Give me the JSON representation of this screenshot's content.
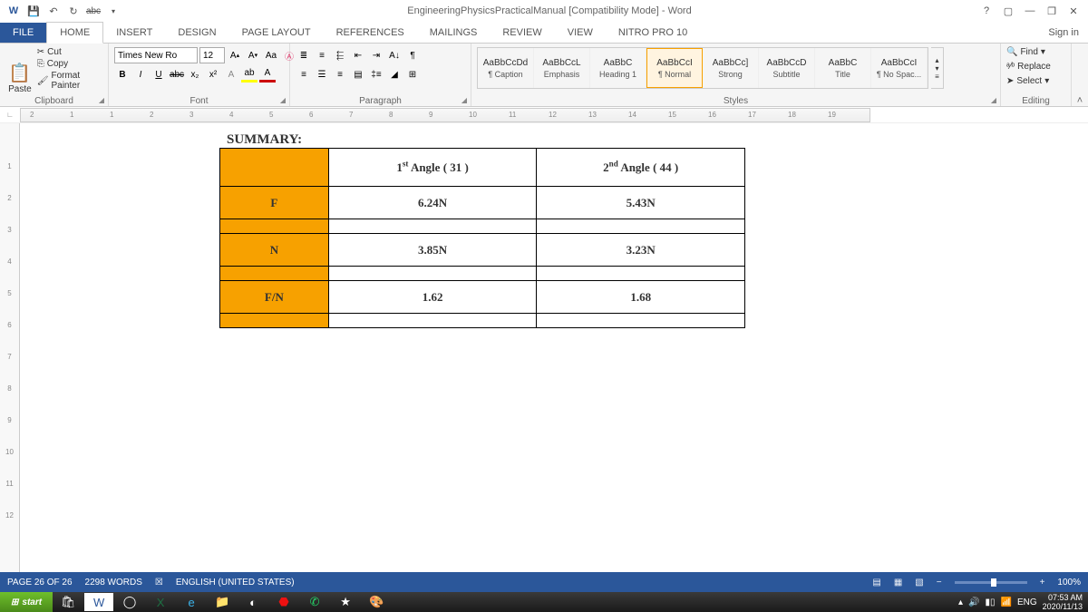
{
  "title": "EngineeringPhysicsPracticalManual [Compatibility Mode] - Word",
  "tabs": {
    "file": "FILE",
    "home": "HOME",
    "insert": "INSERT",
    "design": "DESIGN",
    "pagelayout": "PAGE LAYOUT",
    "references": "REFERENCES",
    "mailings": "MAILINGS",
    "review": "REVIEW",
    "view": "VIEW",
    "nitro": "NITRO PRO 10"
  },
  "signin": "Sign in",
  "clipboard": {
    "paste": "Paste",
    "cut": "Cut",
    "copy": "Copy",
    "painter": "Format Painter",
    "label": "Clipboard"
  },
  "font": {
    "name": "Times New Ro",
    "size": "12",
    "label": "Font"
  },
  "paragraph": {
    "label": "Paragraph"
  },
  "styles": {
    "label": "Styles",
    "items": [
      {
        "preview": "AaBbCcDd",
        "name": "¶ Caption"
      },
      {
        "preview": "AaBbCcL",
        "name": "Emphasis"
      },
      {
        "preview": "AaBbC",
        "name": "Heading 1"
      },
      {
        "preview": "AaBbCcI",
        "name": "¶ Normal"
      },
      {
        "preview": "AaBbCc]",
        "name": "Strong"
      },
      {
        "preview": "AaBbCcD",
        "name": "Subtitle"
      },
      {
        "preview": "AaBbC",
        "name": "Title"
      },
      {
        "preview": "AaBbCcI",
        "name": "¶ No Spac..."
      }
    ]
  },
  "editing": {
    "find": "Find",
    "replace": "Replace",
    "select": "Select",
    "label": "Editing"
  },
  "ruler_h": [
    "2",
    "1",
    "1",
    "2",
    "3",
    "4",
    "5",
    "6",
    "7",
    "8",
    "9",
    "10",
    "11",
    "12",
    "13",
    "14",
    "15",
    "16",
    "17",
    "18",
    "19"
  ],
  "ruler_v": [
    "1",
    "2",
    "3",
    "4",
    "5",
    "6",
    "7",
    "8",
    "9",
    "10",
    "11",
    "12"
  ],
  "doc": {
    "summary": "SUMMARY:",
    "hdr1_a": "1",
    "hdr1_b": " Angle (   31   )",
    "hdr2_a": "2",
    "hdr2_b": " Angle ( 44    )",
    "rows": [
      {
        "label": "F",
        "v1": "6.24N",
        "v2": "5.43N"
      },
      {
        "label": "N",
        "v1": "3.85N",
        "v2": "3.23N"
      },
      {
        "label": "F/N",
        "v1": "1.62",
        "v2": "1.68"
      }
    ]
  },
  "status": {
    "page": "PAGE 26 OF 26",
    "words": "2298 WORDS",
    "lang": "ENGLISH (UNITED STATES)",
    "zoom": "100%"
  },
  "taskbar": {
    "start": "start",
    "lang": "ENG",
    "time": "07:53 AM",
    "date": "2020/11/13"
  }
}
